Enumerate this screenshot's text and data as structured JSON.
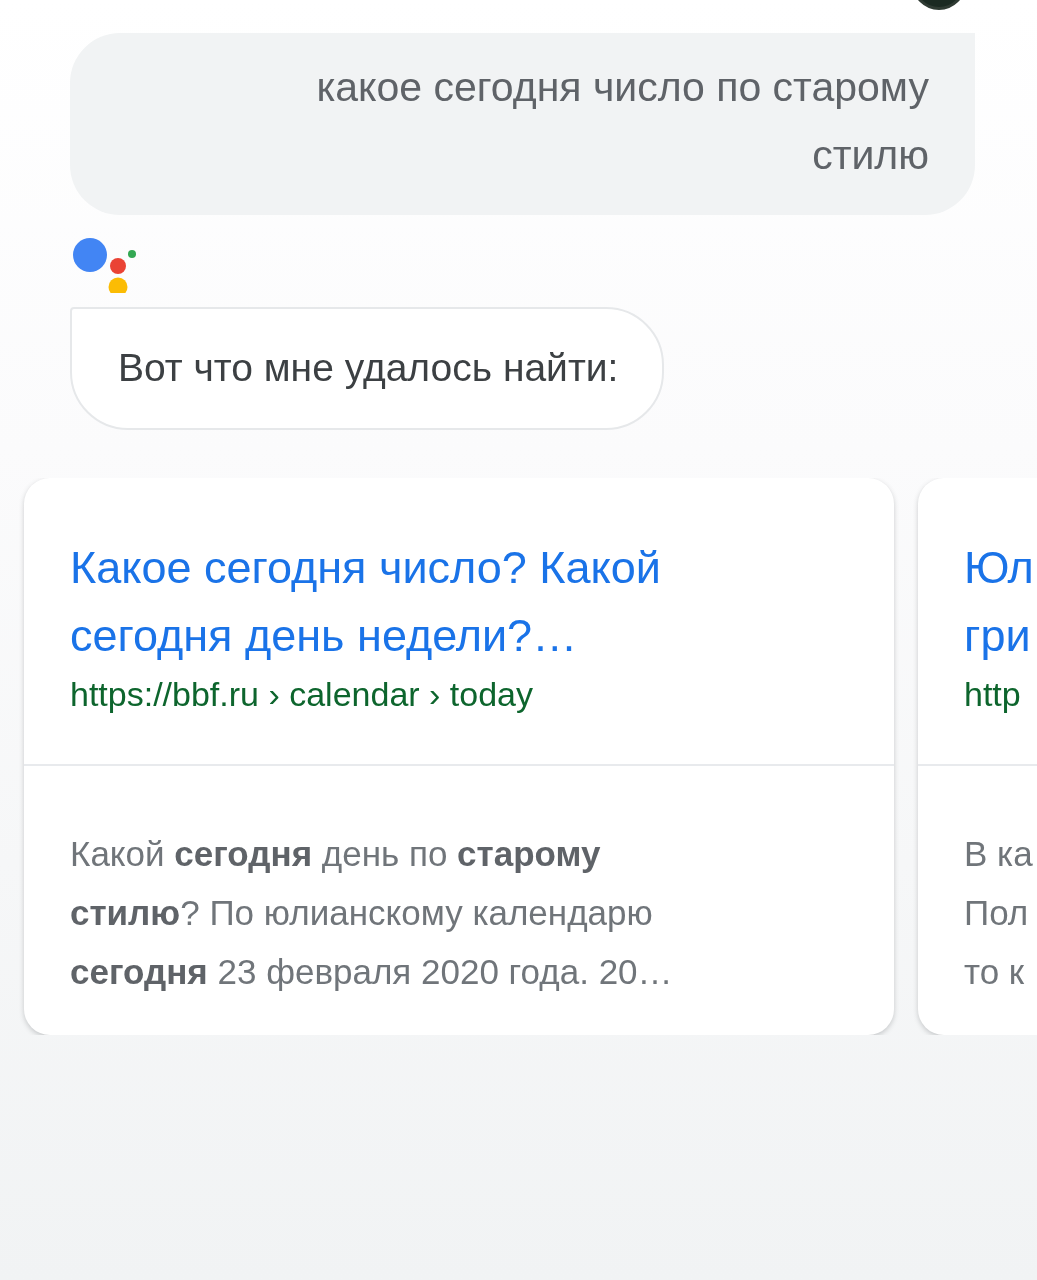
{
  "user_query": {
    "text": "какое сегодня число по старому стилю"
  },
  "assistant": {
    "text": "Вот что мне удалось найти:"
  },
  "results": [
    {
      "title_lines": [
        "Какое сегодня число? Какой",
        "сегодня день недели?…"
      ],
      "url": "https://bbf.ru › calendar › today",
      "snippet_lines": [
        "Какой **сегодня** день по **старому**",
        "**стилю**? По юлианскому календарю",
        "**сегодня** 23 февраля 2020 года. 20…"
      ]
    },
    {
      "title_lines": [
        "Юл",
        "гри"
      ],
      "url": "http",
      "snippet_lines": [
        "В ка",
        "Пол",
        "то к"
      ]
    }
  ]
}
